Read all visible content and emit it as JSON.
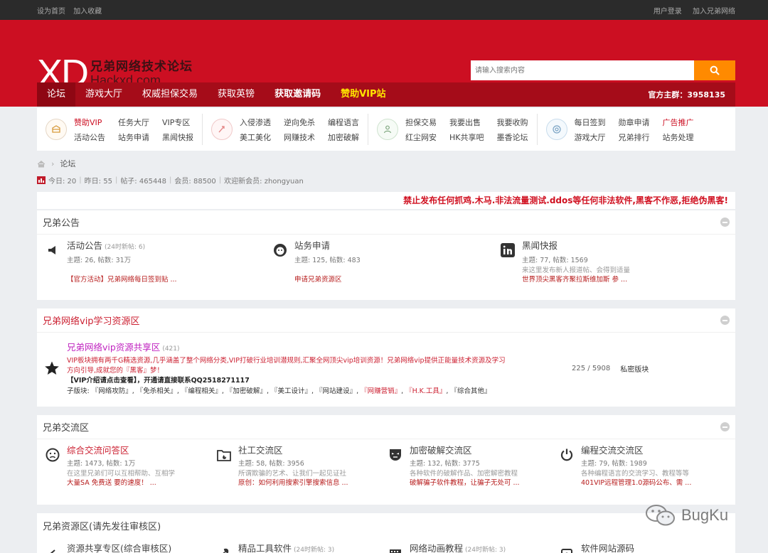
{
  "topbar": {
    "left": [
      "设为首页",
      "加入收藏"
    ],
    "right": [
      "用户登录",
      "加入兄弟网络"
    ]
  },
  "logo": {
    "mark": "XD",
    "cn": "兄弟网络技术论坛",
    "en": "Hackxd.com"
  },
  "search": {
    "placeholder": "请输入搜索内容",
    "icon": "search-icon"
  },
  "nav": {
    "items": [
      "论坛",
      "游戏大厅",
      "权威担保交易",
      "获取英镑",
      "获取邀请码",
      "赞助VIP站"
    ],
    "qq": "官方主群：3958135"
  },
  "quick": [
    {
      "icon": "treasure-icon",
      "links": [
        "赞助VIP",
        "任务大厅",
        "VIP专区",
        "活动公告",
        "站务申请",
        "黑闻快报"
      ]
    },
    {
      "icon": "rocket-icon",
      "links": [
        "入侵渗透",
        "逆向免杀",
        "编程语言",
        "美工美化",
        "网赚技术",
        "加密破解"
      ]
    },
    {
      "icon": "people-icon",
      "links": [
        "担保交易",
        "我要出售",
        "我要收购",
        "红尘网安",
        "HK共享吧",
        "墨香论坛"
      ]
    },
    {
      "icon": "target-icon",
      "links": [
        "每日签到",
        "勋章申请",
        "广告推广",
        "游戏大厅",
        "兄弟排行",
        "站务处理"
      ]
    }
  ],
  "breadcrumb": {
    "current": "论坛"
  },
  "stats": {
    "today": "今日: 20",
    "yesterday": "昨日: 55",
    "posts": "帖子: 465448",
    "members": "会员: 88500",
    "welcome": "欢迎新会员: zhongyuan"
  },
  "notice": "禁止发布任何抓鸡.木马.非法流量测试.ddos等任何非法软件,黑客不作恶,拒绝伪黑客!",
  "sec1": {
    "title": "兄弟公告",
    "forums": [
      {
        "name": "活动公告",
        "new": "(24时新帖: 6)",
        "meta": "主题: 26, 帖数: 31万",
        "desc": "",
        "last": "【官方活动】兄弟网络每日签到贴 ..."
      },
      {
        "name": "站务申请",
        "new": "",
        "meta": "主题: 125, 帖数: 483",
        "desc": "",
        "last": "申请兄弟资源区"
      },
      {
        "name": "黑闻快报",
        "new": "",
        "meta": "主题: 77, 帖数: 1569",
        "desc": "来这里发布新人报道帖、会得到适量",
        "last": "世界顶尖黑客齐聚拉斯维加斯 参 ..."
      }
    ]
  },
  "sec2": {
    "title": "兄弟网络vip学习资源区",
    "forum": {
      "name": "兄弟网络vip资源共享区",
      "count": "(421)",
      "desc": "VIP板块拥有两千G精选资源,几乎涵盖了整个网络分类,VIP打破行业培训潜规则,汇聚全网顶尖vip培训资源！兄弟网络vip提供正能量技术资源及学习方向引导,成就您的『黑客』梦！",
      "contact": "【VIP介绍请点击查看】，开通请直接联系QQ2518271117",
      "subs_label": "子版块:",
      "subs": [
        "『网络攻防』",
        "『免杀相关』",
        "『编程相关』",
        "『加密破解』",
        "『美工设计』",
        "『网站建设』",
        "『网赚营销』",
        "『H.K.工具』",
        "『综合其他』"
      ],
      "stats": "225 / 5908",
      "moderator": "私密版块"
    }
  },
  "sec3": {
    "title": "兄弟交流区",
    "forums": [
      {
        "name": "综合交流问答区",
        "meta": "主题: 1473, 帖数: 1万",
        "desc": "在这里兄弟们可以互相帮助、互相学",
        "last": "大量SA 免费送 要的速度！ ..."
      },
      {
        "name": "社工交流区",
        "meta": "主题: 58, 帖数: 3956",
        "desc": "所谓欺骗的艺术、让我们一起见证社",
        "last": "原创：如何利用搜索引擎搜索信息 ..."
      },
      {
        "name": "加密破解交流区",
        "meta": "主题: 132, 帖数: 3775",
        "desc": "各种软件的破解作品、加密解密教程",
        "last": "破解骗子软件教程，让骗子无处可 ..."
      },
      {
        "name": "编程交流交流区",
        "meta": "主题: 79, 帖数: 1989",
        "desc": "各种编程语言的交流学习、教程等等",
        "last": "401VIP远程管理1.0源码公布、需 ..."
      }
    ]
  },
  "sec4": {
    "title": "兄弟资源区(请先发往审核区)",
    "forums": [
      {
        "name": "资源共享专区(综合审核区)",
        "new": ""
      },
      {
        "name": "精品工具软件",
        "new": "(24时新帖: 3)"
      },
      {
        "name": "网络动画教程",
        "new": "(24时新帖: 3)"
      },
      {
        "name": "软件网站源码",
        "new": ""
      }
    ]
  },
  "watermark": "BugKu",
  "colors": {
    "brand": "#cc0f22",
    "nav": "#a50c19",
    "search_button": "#ff8a00",
    "accent_text": "#cc2233"
  }
}
